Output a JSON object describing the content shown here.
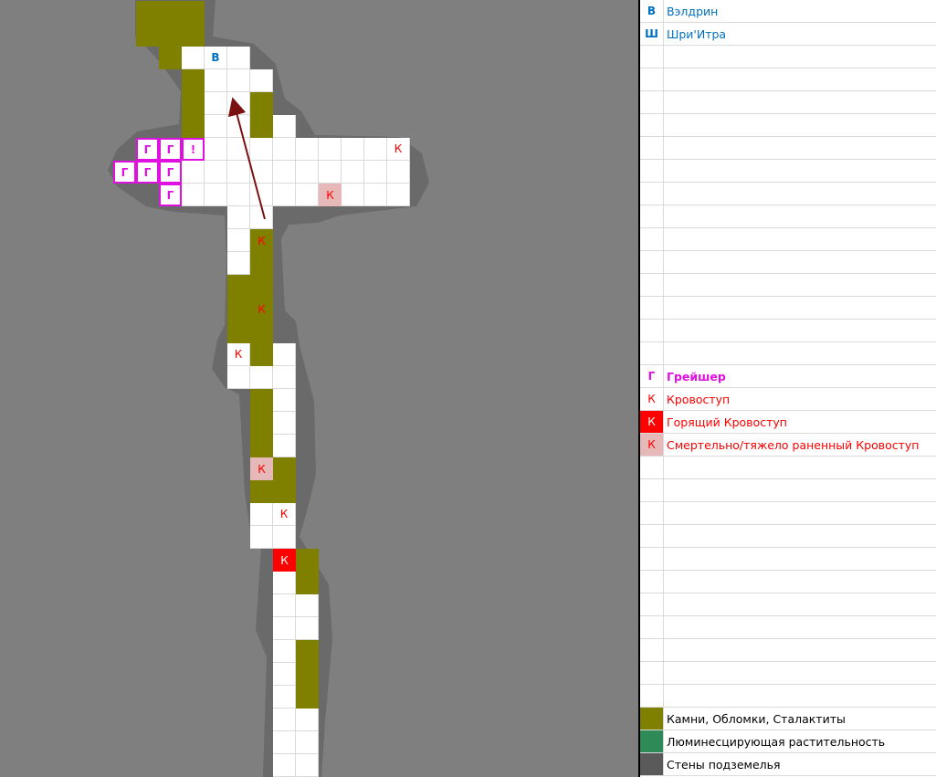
{
  "map": {
    "title": "",
    "colors": {
      "background": "#7f7f7f",
      "wall": "#6a6a6a",
      "floor": "#ffffff",
      "rocks": "#808000",
      "wounded": "#e6b8b7",
      "burning": "#ff0000",
      "grayscher_outline": "#e010e0",
      "arrow": "#7a1010"
    },
    "rows": [
      {
        "row": 0,
        "cells": [
          [
            6,
            "O"
          ],
          [
            7,
            "O"
          ],
          [
            8,
            "O"
          ]
        ]
      },
      {
        "row": 1,
        "cells": [
          [
            6,
            "O"
          ],
          [
            7,
            "O"
          ],
          [
            8,
            "O"
          ]
        ]
      },
      {
        "row": 2,
        "cells": [
          [
            7,
            "O"
          ],
          [
            8,
            "W"
          ],
          [
            9,
            "W",
            "В"
          ],
          [
            10,
            "W"
          ]
        ]
      },
      {
        "row": 3,
        "cells": [
          [
            8,
            "O"
          ],
          [
            9,
            "W"
          ],
          [
            10,
            "W"
          ],
          [
            11,
            "W"
          ]
        ]
      },
      {
        "row": 4,
        "cells": [
          [
            8,
            "O"
          ],
          [
            9,
            "W"
          ],
          [
            10,
            "W"
          ],
          [
            11,
            "O"
          ]
        ]
      },
      {
        "row": 5,
        "cells": [
          [
            8,
            "O"
          ],
          [
            9,
            "W"
          ],
          [
            10,
            "W"
          ],
          [
            11,
            "O"
          ],
          [
            12,
            "W"
          ]
        ]
      },
      {
        "row": 6,
        "cells": [
          [
            6,
            "M",
            "Г"
          ],
          [
            7,
            "M",
            "Г"
          ],
          [
            8,
            "M",
            "!"
          ],
          [
            9,
            "W"
          ],
          [
            10,
            "W"
          ],
          [
            11,
            "W"
          ],
          [
            12,
            "W"
          ],
          [
            13,
            "W"
          ],
          [
            14,
            "W"
          ],
          [
            15,
            "W"
          ],
          [
            16,
            "W"
          ],
          [
            17,
            "W",
            "К"
          ]
        ]
      },
      {
        "row": 7,
        "cells": [
          [
            5,
            "M",
            "Г"
          ],
          [
            6,
            "M",
            "Г"
          ],
          [
            7,
            "M",
            "Г"
          ],
          [
            8,
            "W"
          ],
          [
            9,
            "W"
          ],
          [
            10,
            "W"
          ],
          [
            11,
            "W"
          ],
          [
            12,
            "W"
          ],
          [
            13,
            "W"
          ],
          [
            14,
            "W"
          ],
          [
            15,
            "W"
          ],
          [
            16,
            "W"
          ],
          [
            17,
            "W"
          ]
        ]
      },
      {
        "row": 8,
        "cells": [
          [
            7,
            "M",
            "Г"
          ],
          [
            8,
            "W"
          ],
          [
            9,
            "W"
          ],
          [
            10,
            "W"
          ],
          [
            11,
            "W"
          ],
          [
            12,
            "W"
          ],
          [
            13,
            "W"
          ],
          [
            14,
            "S",
            "К"
          ],
          [
            15,
            "W"
          ],
          [
            16,
            "W"
          ],
          [
            17,
            "W"
          ]
        ]
      },
      {
        "row": 9,
        "cells": [
          [
            10,
            "W"
          ],
          [
            11,
            "W"
          ]
        ]
      },
      {
        "row": 10,
        "cells": [
          [
            10,
            "W"
          ],
          [
            11,
            "O",
            "К"
          ]
        ]
      },
      {
        "row": 11,
        "cells": [
          [
            10,
            "W"
          ],
          [
            11,
            "O"
          ]
        ]
      },
      {
        "row": 12,
        "cells": [
          [
            10,
            "O"
          ],
          [
            11,
            "O"
          ]
        ]
      },
      {
        "row": 13,
        "cells": [
          [
            10,
            "O"
          ],
          [
            11,
            "O",
            "К"
          ]
        ]
      },
      {
        "row": 14,
        "cells": [
          [
            10,
            "O"
          ],
          [
            11,
            "O"
          ]
        ]
      },
      {
        "row": 15,
        "cells": [
          [
            10,
            "W",
            "К"
          ],
          [
            11,
            "O"
          ],
          [
            12,
            "W"
          ]
        ]
      },
      {
        "row": 16,
        "cells": [
          [
            10,
            "W"
          ],
          [
            11,
            "W"
          ],
          [
            12,
            "W"
          ]
        ]
      },
      {
        "row": 17,
        "cells": [
          [
            11,
            "O"
          ],
          [
            12,
            "W"
          ]
        ]
      },
      {
        "row": 18,
        "cells": [
          [
            11,
            "O"
          ],
          [
            12,
            "W"
          ]
        ]
      },
      {
        "row": 19,
        "cells": [
          [
            11,
            "O"
          ],
          [
            12,
            "W"
          ]
        ]
      },
      {
        "row": 20,
        "cells": [
          [
            11,
            "S",
            "К"
          ],
          [
            12,
            "O"
          ]
        ]
      },
      {
        "row": 21,
        "cells": [
          [
            11,
            "O"
          ],
          [
            12,
            "O"
          ]
        ]
      },
      {
        "row": 22,
        "cells": [
          [
            11,
            "W"
          ],
          [
            12,
            "W",
            "К"
          ]
        ]
      },
      {
        "row": 23,
        "cells": [
          [
            11,
            "W"
          ],
          [
            12,
            "W"
          ]
        ]
      },
      {
        "row": 24,
        "cells": [
          [
            12,
            "R",
            "К"
          ],
          [
            13,
            "O"
          ]
        ]
      },
      {
        "row": 25,
        "cells": [
          [
            12,
            "W"
          ],
          [
            13,
            "O"
          ]
        ]
      },
      {
        "row": 26,
        "cells": [
          [
            12,
            "W"
          ],
          [
            13,
            "W"
          ]
        ]
      },
      {
        "row": 27,
        "cells": [
          [
            12,
            "W"
          ],
          [
            13,
            "W"
          ]
        ]
      },
      {
        "row": 28,
        "cells": [
          [
            12,
            "W"
          ],
          [
            13,
            "O"
          ]
        ]
      },
      {
        "row": 29,
        "cells": [
          [
            12,
            "W"
          ],
          [
            13,
            "O"
          ]
        ]
      },
      {
        "row": 30,
        "cells": [
          [
            12,
            "W"
          ],
          [
            13,
            "O"
          ]
        ]
      },
      {
        "row": 31,
        "cells": [
          [
            12,
            "W"
          ],
          [
            13,
            "W"
          ]
        ]
      },
      {
        "row": 32,
        "cells": [
          [
            12,
            "W"
          ],
          [
            13,
            "W"
          ]
        ]
      },
      {
        "row": 33,
        "cells": [
          [
            12,
            "W"
          ],
          [
            13,
            "W"
          ]
        ]
      }
    ]
  },
  "legend": {
    "characters": [
      {
        "symbol": "В",
        "name": "Вэлдрин",
        "color": "#0070c0",
        "bold": false
      },
      {
        "symbol": "Ш",
        "name": "Шри'Итра",
        "color": "#0070c0",
        "bold": false
      }
    ],
    "enemies": [
      {
        "symbol": "Г",
        "name": "Грейшер",
        "color": "#e010e0",
        "fill": "",
        "bold": true
      },
      {
        "symbol": "К",
        "name": "Кровоступ",
        "color": "#ff0000",
        "fill": "",
        "bold": false
      },
      {
        "symbol": "К",
        "name": "Горящий Кровоступ",
        "color": "#ff0000",
        "fill": "#ff0000",
        "bold": false
      },
      {
        "symbol": "К",
        "name": "Смертельно/тяжело раненный Кровоступ",
        "color": "#ff0000",
        "fill": "#e6b8b7",
        "bold": false
      }
    ],
    "terrain": [
      {
        "name": "Камни, Обломки, Сталактиты",
        "fill": "#808000"
      },
      {
        "name": "Люминесцирующая растительность",
        "fill": "#2e8b57"
      },
      {
        "name": "Стены подземелья",
        "fill": "#5a5a5a"
      }
    ]
  }
}
